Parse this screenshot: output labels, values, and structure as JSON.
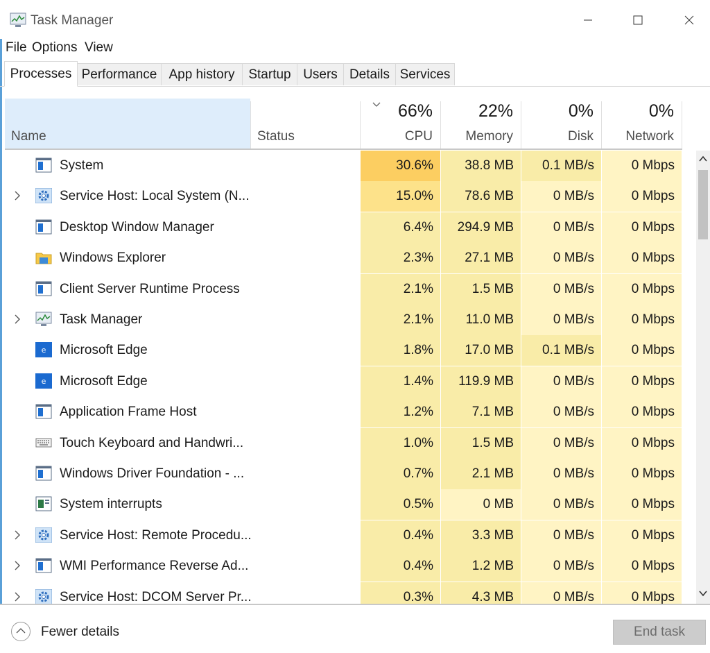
{
  "window": {
    "title": "Task Manager"
  },
  "menu": [
    "File",
    "Options",
    "View"
  ],
  "tabs": [
    "Processes",
    "Performance",
    "App history",
    "Startup",
    "Users",
    "Details",
    "Services"
  ],
  "active_tab": "Processes",
  "columns": {
    "name": "Name",
    "status": "Status",
    "cpu": {
      "label": "CPU",
      "pct": "66%"
    },
    "memory": {
      "label": "Memory",
      "pct": "22%"
    },
    "disk": {
      "label": "Disk",
      "pct": "0%"
    },
    "network": {
      "label": "Network",
      "pct": "0%"
    }
  },
  "processes": [
    {
      "name": "System",
      "icon": "window-app-icon",
      "expandable": false,
      "cpu": "30.6%",
      "memory": "38.8 MB",
      "disk": "0.1 MB/s",
      "network": "0 Mbps",
      "heat": {
        "cpu": 3,
        "memory": 1,
        "disk": 1,
        "network": 0
      }
    },
    {
      "name": "Service Host: Local System (N...",
      "icon": "gear-service-icon",
      "expandable": true,
      "cpu": "15.0%",
      "memory": "78.6 MB",
      "disk": "0 MB/s",
      "network": "0 Mbps",
      "heat": {
        "cpu": 2,
        "memory": 1,
        "disk": 0,
        "network": 0
      }
    },
    {
      "name": "Desktop Window Manager",
      "icon": "window-app-icon",
      "expandable": false,
      "cpu": "6.4%",
      "memory": "294.9 MB",
      "disk": "0 MB/s",
      "network": "0 Mbps",
      "heat": {
        "cpu": 1,
        "memory": 1,
        "disk": 0,
        "network": 0
      }
    },
    {
      "name": "Windows Explorer",
      "icon": "folder-explorer-icon",
      "expandable": false,
      "cpu": "2.3%",
      "memory": "27.1 MB",
      "disk": "0 MB/s",
      "network": "0 Mbps",
      "heat": {
        "cpu": 1,
        "memory": 1,
        "disk": 0,
        "network": 0
      }
    },
    {
      "name": "Client Server Runtime Process",
      "icon": "window-app-icon",
      "expandable": false,
      "cpu": "2.1%",
      "memory": "1.5 MB",
      "disk": "0 MB/s",
      "network": "0 Mbps",
      "heat": {
        "cpu": 1,
        "memory": 1,
        "disk": 0,
        "network": 0
      }
    },
    {
      "name": "Task Manager",
      "icon": "task-manager-icon",
      "expandable": true,
      "cpu": "2.1%",
      "memory": "11.0 MB",
      "disk": "0 MB/s",
      "network": "0 Mbps",
      "heat": {
        "cpu": 1,
        "memory": 1,
        "disk": 0,
        "network": 0
      }
    },
    {
      "name": "Microsoft Edge",
      "icon": "edge-icon",
      "expandable": false,
      "cpu": "1.8%",
      "memory": "17.0 MB",
      "disk": "0.1 MB/s",
      "network": "0 Mbps",
      "heat": {
        "cpu": 1,
        "memory": 1,
        "disk": 1,
        "network": 0
      }
    },
    {
      "name": "Microsoft Edge",
      "icon": "edge-icon",
      "expandable": false,
      "cpu": "1.4%",
      "memory": "119.9 MB",
      "disk": "0 MB/s",
      "network": "0 Mbps",
      "heat": {
        "cpu": 1,
        "memory": 1,
        "disk": 0,
        "network": 0
      }
    },
    {
      "name": "Application Frame Host",
      "icon": "window-app-icon",
      "expandable": false,
      "cpu": "1.2%",
      "memory": "7.1 MB",
      "disk": "0 MB/s",
      "network": "0 Mbps",
      "heat": {
        "cpu": 1,
        "memory": 1,
        "disk": 0,
        "network": 0
      }
    },
    {
      "name": "Touch Keyboard and Handwri...",
      "icon": "keyboard-icon",
      "expandable": false,
      "cpu": "1.0%",
      "memory": "1.5 MB",
      "disk": "0 MB/s",
      "network": "0 Mbps",
      "heat": {
        "cpu": 1,
        "memory": 1,
        "disk": 0,
        "network": 0
      }
    },
    {
      "name": "Windows Driver Foundation - ...",
      "icon": "window-app-icon",
      "expandable": false,
      "cpu": "0.7%",
      "memory": "2.1 MB",
      "disk": "0 MB/s",
      "network": "0 Mbps",
      "heat": {
        "cpu": 1,
        "memory": 1,
        "disk": 0,
        "network": 0
      }
    },
    {
      "name": "System interrupts",
      "icon": "interrupts-icon",
      "expandable": false,
      "cpu": "0.5%",
      "memory": "0 MB",
      "disk": "0 MB/s",
      "network": "0 Mbps",
      "heat": {
        "cpu": 1,
        "memory": 0,
        "disk": 0,
        "network": 0
      }
    },
    {
      "name": "Service Host: Remote Procedu...",
      "icon": "gear-service-icon",
      "expandable": true,
      "cpu": "0.4%",
      "memory": "3.3 MB",
      "disk": "0 MB/s",
      "network": "0 Mbps",
      "heat": {
        "cpu": 1,
        "memory": 1,
        "disk": 0,
        "network": 0
      }
    },
    {
      "name": "WMI Performance Reverse Ad...",
      "icon": "window-app-icon",
      "expandable": true,
      "cpu": "0.4%",
      "memory": "1.2 MB",
      "disk": "0 MB/s",
      "network": "0 Mbps",
      "heat": {
        "cpu": 1,
        "memory": 1,
        "disk": 0,
        "network": 0
      }
    },
    {
      "name": "Service Host: DCOM Server Pr...",
      "icon": "gear-service-icon",
      "expandable": true,
      "cpu": "0.3%",
      "memory": "4.3 MB",
      "disk": "0 MB/s",
      "network": "0 Mbps",
      "heat": {
        "cpu": 1,
        "memory": 1,
        "disk": 0,
        "network": 0
      }
    }
  ],
  "heat_colors": [
    "#fff4c4",
    "#f9eca8",
    "#fde28a",
    "#fcce61"
  ],
  "footer": {
    "fewer_details": "Fewer details",
    "end_task": "End task"
  }
}
